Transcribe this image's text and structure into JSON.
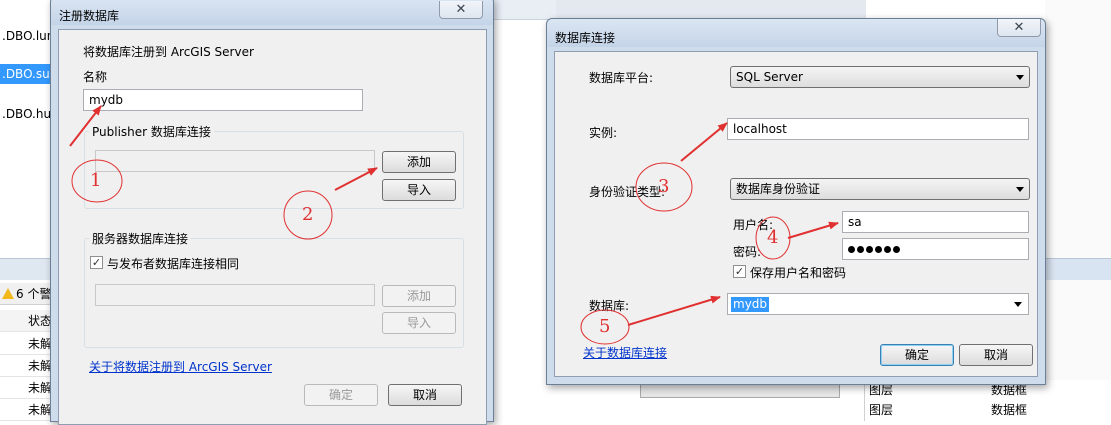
{
  "background": {
    "list_items": [
      ".DBO.lun",
      ".DBO.sus",
      ".DBO.hua"
    ],
    "warning_text": "6 个警",
    "column_header": "状态",
    "rows": [
      "未解",
      "未解",
      "未解",
      "未解"
    ],
    "layers": [
      {
        "name": "图层",
        "type": "数据框"
      },
      {
        "name": "图层",
        "type": "数据框"
      }
    ]
  },
  "register_dialog": {
    "title": "注册数据库",
    "close_symbol": "✕",
    "intro": "将数据库注册到 ArcGIS Server",
    "name_label": "名称",
    "name_value": "mydb",
    "publisher_group": "Publisher 数据库连接",
    "add_button": "添加",
    "import_button": "导入",
    "server_group": "服务器数据库连接",
    "same_as_publisher": "与发布者数据库连接相同",
    "same_as_publisher_checked": true,
    "server_add_button": "添加",
    "server_import_button": "导入",
    "about_link": "关于将数据注册到 ArcGIS Server",
    "ok_button": "确定",
    "cancel_button": "取消"
  },
  "connection_dialog": {
    "title": "数据库连接",
    "close_symbol": "✕",
    "platform_label": "数据库平台:",
    "platform_value": "SQL Server",
    "instance_label": "实例:",
    "instance_value": "localhost",
    "auth_label": "身份验证类型:",
    "auth_value": "数据库身份验证",
    "username_label": "用户名:",
    "username_value": "sa",
    "password_label": "密码:",
    "password_dots": 6,
    "save_credentials": "保存用户名和密码",
    "save_credentials_checked": true,
    "database_label": "数据库:",
    "database_value": "mydb",
    "about_link": "关于数据库连接",
    "ok_button": "确定",
    "cancel_button": "取消"
  },
  "annotations": {
    "color": "#e03030",
    "steps": [
      "1",
      "2",
      "3",
      "4",
      "5"
    ]
  }
}
